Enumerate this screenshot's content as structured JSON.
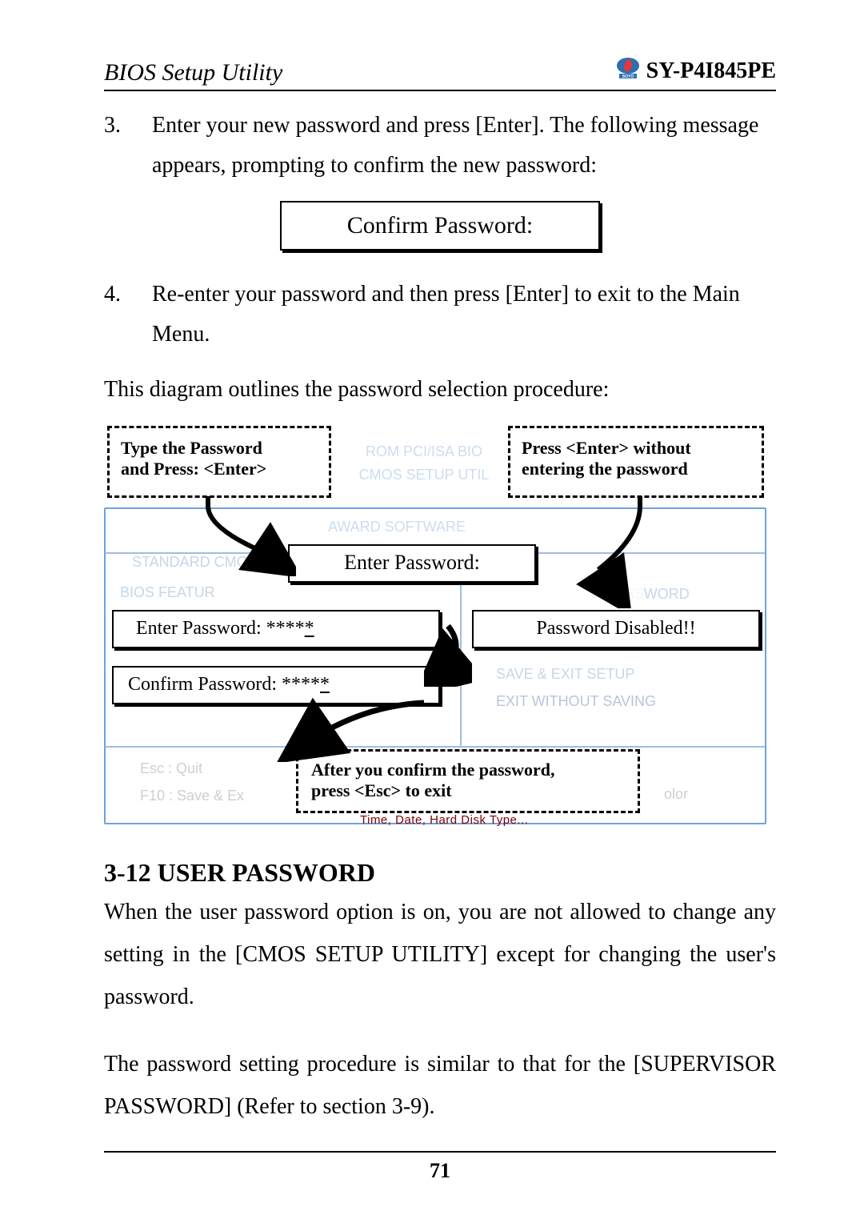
{
  "header": {
    "left": "BIOS Setup Utility",
    "right": "SY-P4I845PE",
    "brand_sub": "SOYO"
  },
  "steps": {
    "s3_num": "3.",
    "s3_text": "Enter your new password and press [Enter]. The following message appears, prompting to confirm the new password:",
    "confirm_box": "Confirm Password:",
    "s4_num": "4.",
    "s4_text": "Re-enter your password and then press [Enter] to exit to the Main Menu."
  },
  "intro": "This diagram outlines the password selection procedure:",
  "diagram": {
    "type_password": "Type the Password and Press: <Enter>",
    "rom_line1": "ROM PCI/ISA BIO",
    "rom_line2": "CMOS SETUP UTIL",
    "rom_line3": "AWARD SOFTWARE",
    "press_enter_without": "Press <Enter> without entering the password",
    "enter_password_title": "Enter Password:",
    "standard": "STANDARD CMO",
    "bios_feat": "BIOS FEATUR",
    "enter_pw_masked": "Enter Password: *****",
    "confirm_pw_masked": "Confirm Password: *****",
    "pw_disabled": "Password Disabled!!",
    "password_label": "PASSWORD",
    "save_exit": "SAVE & EXIT SETUP",
    "exit_without": "EXIT WITHOUT SAVING",
    "esc_quit": "Esc  : Quit",
    "f10_save": "F10  : Save & Ex",
    "after_confirm": "After you confirm the password, press <Esc> to exit",
    "olor": "olor",
    "time_date": "Time, Date, Hard Disk Type..."
  },
  "section": {
    "heading": "3-12  USER PASSWORD",
    "para1": "When the user password option is on, you are not allowed to change any setting in the [CMOS SETUP UTILITY] except for changing the user's password.",
    "para2": "The password setting procedure is similar to that for the [SUPERVISOR PASSWORD] (Refer to section 3-9)."
  },
  "footer": {
    "page": "71"
  }
}
